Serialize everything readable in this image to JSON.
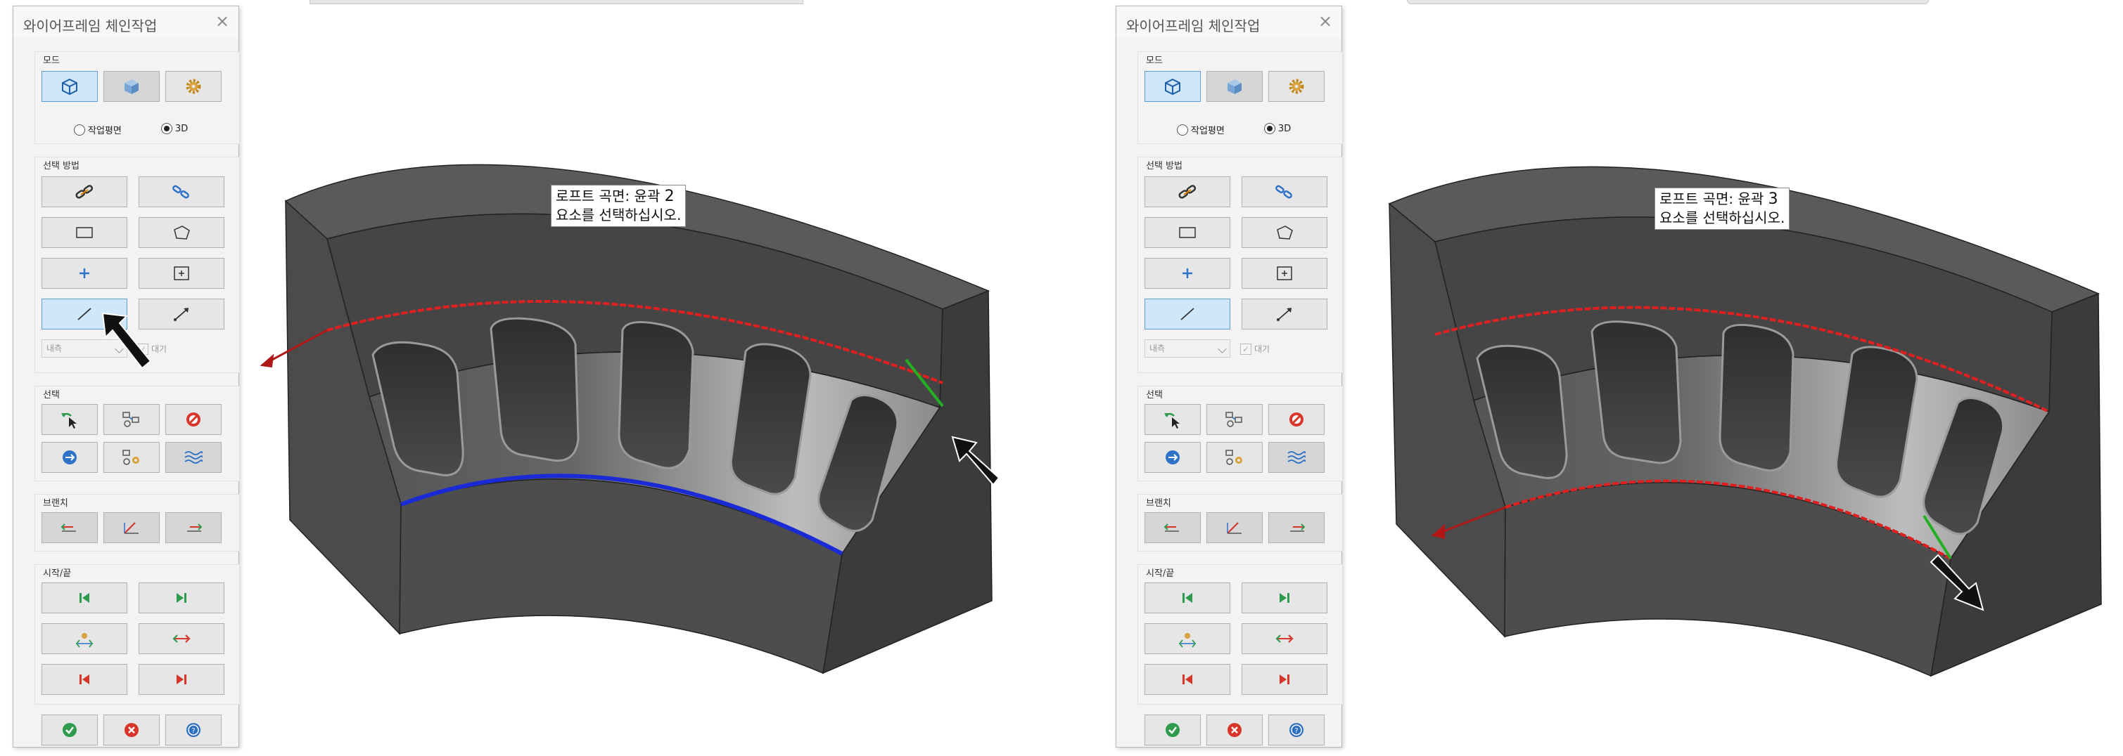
{
  "panels": [
    {
      "title": "와이어프레임 체인작업",
      "close": "×",
      "mode": {
        "label": "모드",
        "plane_label": "작업평면",
        "d3_label": "3D",
        "selected": "3D"
      },
      "selection_method": {
        "label": "선택 방법",
        "combo_value": "내측",
        "wait_label": "대기"
      },
      "selection": {
        "label": "선택"
      },
      "branch": {
        "label": "브랜치"
      },
      "start_end": {
        "label": "시작/끝"
      }
    },
    {
      "title": "와이어프레임 체인작업",
      "close": "×",
      "mode": {
        "label": "모드",
        "plane_label": "작업평면",
        "d3_label": "3D",
        "selected": "3D"
      },
      "selection_method": {
        "label": "선택 방법",
        "combo_value": "내측",
        "wait_label": "대기"
      },
      "selection": {
        "label": "선택"
      },
      "branch": {
        "label": "브랜치"
      },
      "start_end": {
        "label": "시작/끝"
      }
    }
  ],
  "prompts": [
    {
      "line1_prefix": "로프트 곡면: 윤곽 ",
      "number": "2",
      "line2": "요소를 선택하십시오."
    },
    {
      "line1_prefix": "로프트 곡면: 윤곽 ",
      "number": "3",
      "line2": "요소를 선택하십시오."
    }
  ],
  "colors": {
    "selected_chain": "#e02020",
    "profile_2": "#1a2bd6",
    "start_marker": "#22b022",
    "active_button": "#cfe6fb",
    "ok_green": "#2e9b4f",
    "cancel_red": "#d9362b",
    "help_blue": "#2d6fc0"
  }
}
